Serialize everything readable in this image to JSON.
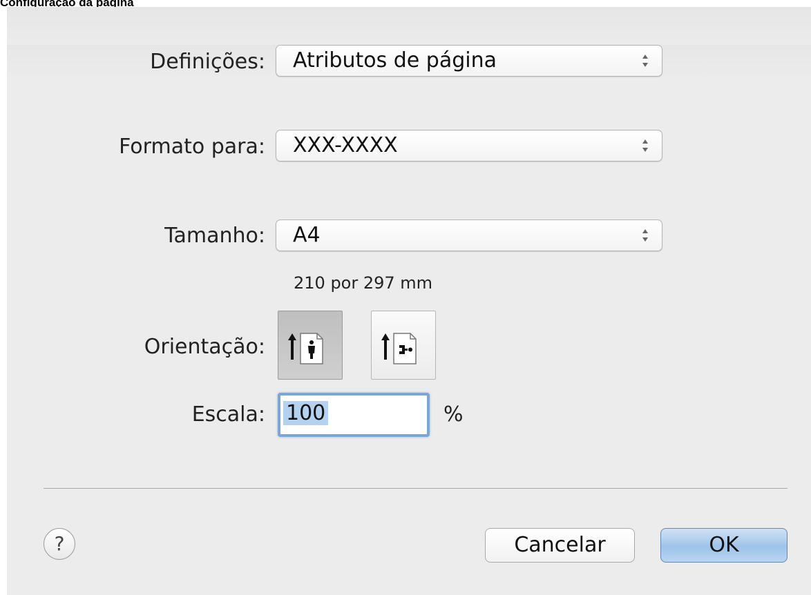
{
  "caption": "Configuração da página",
  "form": {
    "settings_label": "Definições:",
    "settings_value": "Atributos de página",
    "format_label": "Formato para:",
    "format_value": "XXX-XXXX",
    "size_label": "Tamanho:",
    "size_value": "A4",
    "size_dims": "210 por 297 mm",
    "orientation_label": "Orientação:",
    "orientation_options": [
      "portrait",
      "landscape"
    ],
    "orientation_selected": "portrait",
    "scale_label": "Escala:",
    "scale_value": "100",
    "scale_unit": "%"
  },
  "buttons": {
    "help": "?",
    "cancel": "Cancelar",
    "ok": "OK"
  },
  "colors": {
    "background": "#ececec",
    "focus_ring": "#7aa7d8",
    "selection": "#b5d1f0",
    "default_button": "#9fc3ea"
  }
}
